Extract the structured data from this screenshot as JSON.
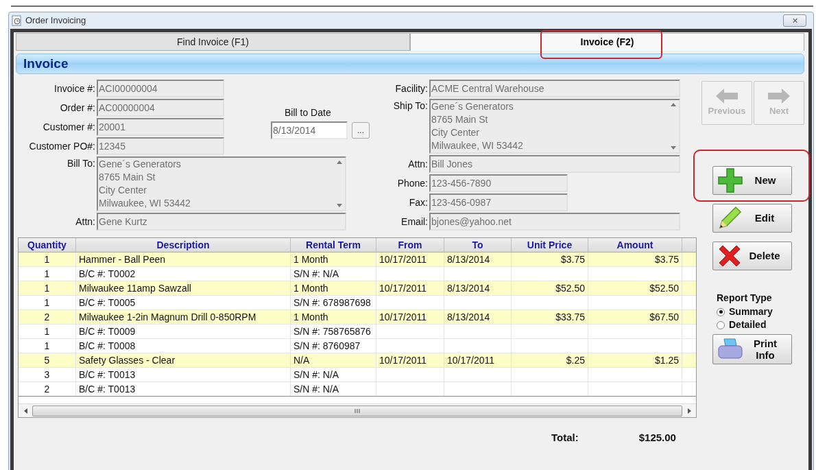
{
  "window": {
    "title": "Order Invoicing",
    "close": "✕"
  },
  "tabs": [
    {
      "label": "Find Invoice (F1)",
      "selected": false,
      "highlighted": false
    },
    {
      "label": "Invoice (F2)",
      "selected": true,
      "highlighted": true
    }
  ],
  "section_title": "Invoice",
  "left_fields": [
    {
      "label": "Invoice #:",
      "value": "ACI00000004"
    },
    {
      "label": "Order #:",
      "value": "AC00000004"
    },
    {
      "label": "Customer #:",
      "value": "20001"
    },
    {
      "label": "Customer PO#:",
      "value": "12345"
    }
  ],
  "bill_to": {
    "label": "Bill To:",
    "lines": [
      "Gene´s Generators",
      "8765 Main St",
      "City Center",
      "Milwaukee, WI  53442"
    ]
  },
  "bill_attn": {
    "label": "Attn:",
    "value": "Gene Kurtz"
  },
  "bill_to_date": {
    "label": "Bill to Date",
    "value": "8/13/2014",
    "picker": "..."
  },
  "facility": {
    "label": "Facility:",
    "value": "ACME Central Warehouse"
  },
  "ship_to": {
    "label": "Ship To:",
    "lines": [
      "Gene´s Generators",
      "8765 Main St",
      "City Center",
      "Milwaukee, WI  53442"
    ]
  },
  "right_fields": [
    {
      "label": "Attn:",
      "value": "Bill Jones",
      "wide": true
    },
    {
      "label": "Phone:",
      "value": "123-456-7890",
      "wide": false
    },
    {
      "label": "Fax:",
      "value": "123-456-0987",
      "wide": false
    },
    {
      "label": "Email:",
      "value": "bjones@yahoo.net",
      "wide": true
    }
  ],
  "nav_buttons": [
    {
      "label": "Previous",
      "kind": "previous",
      "disabled": true
    },
    {
      "label": "Next",
      "kind": "next",
      "disabled": true
    }
  ],
  "action_buttons": [
    {
      "label": "New",
      "kind": "new",
      "highlighted": true
    },
    {
      "label": "Edit",
      "kind": "edit",
      "highlighted": false
    },
    {
      "label": "Delete",
      "kind": "delete",
      "highlighted": false
    }
  ],
  "report_type": {
    "label": "Report Type",
    "options": [
      {
        "label": "Summary",
        "selected": true
      },
      {
        "label": "Detailed",
        "selected": false
      }
    ]
  },
  "print_button": {
    "label": "Print Info"
  },
  "table": {
    "columns": [
      "Quantity",
      "Description",
      "Rental Term",
      "From",
      "To",
      "Unit Price",
      "Amount"
    ],
    "rows": [
      {
        "kind": "item",
        "cells": [
          "1",
          "Hammer - Ball Peen",
          "1 Month",
          "10/17/2011",
          "8/13/2014",
          "$3.75",
          "$3.75"
        ]
      },
      {
        "kind": "detail",
        "cells": [
          "1",
          "B/C #: T0002",
          "S/N #: N/A",
          "",
          "",
          "",
          ""
        ]
      },
      {
        "kind": "item",
        "cells": [
          "1",
          "Milwaukee 11amp Sawzall",
          "1 Month",
          "10/17/2011",
          "8/13/2014",
          "$52.50",
          "$52.50"
        ]
      },
      {
        "kind": "detail",
        "cells": [
          "1",
          "B/C #: T0005",
          "S/N #: 678987698",
          "",
          "",
          "",
          ""
        ]
      },
      {
        "kind": "item",
        "cells": [
          "2",
          "Milwaukee 1-2in Magnum Drill 0-850RPM",
          "1 Month",
          "10/17/2011",
          "8/13/2014",
          "$33.75",
          "$67.50"
        ]
      },
      {
        "kind": "detail",
        "cells": [
          "1",
          "B/C #: T0009",
          "S/N #: 758765876",
          "",
          "",
          "",
          ""
        ]
      },
      {
        "kind": "detail",
        "cells": [
          "1",
          "B/C #: T0008",
          "S/N #: 8760987",
          "",
          "",
          "",
          ""
        ]
      },
      {
        "kind": "item",
        "cells": [
          "5",
          "Safety Glasses - Clear",
          "N/A",
          "10/17/2011",
          "10/17/2011",
          "$.25",
          "$1.25"
        ]
      },
      {
        "kind": "detail",
        "cells": [
          "3",
          "B/C #: T0013",
          "S/N #: N/A",
          "",
          "",
          "",
          ""
        ]
      },
      {
        "kind": "detail",
        "cells": [
          "2",
          "B/C #: T0013",
          "S/N #: N/A",
          "",
          "",
          "",
          ""
        ]
      }
    ]
  },
  "total": {
    "label": "Total:",
    "value": "$125.00"
  }
}
